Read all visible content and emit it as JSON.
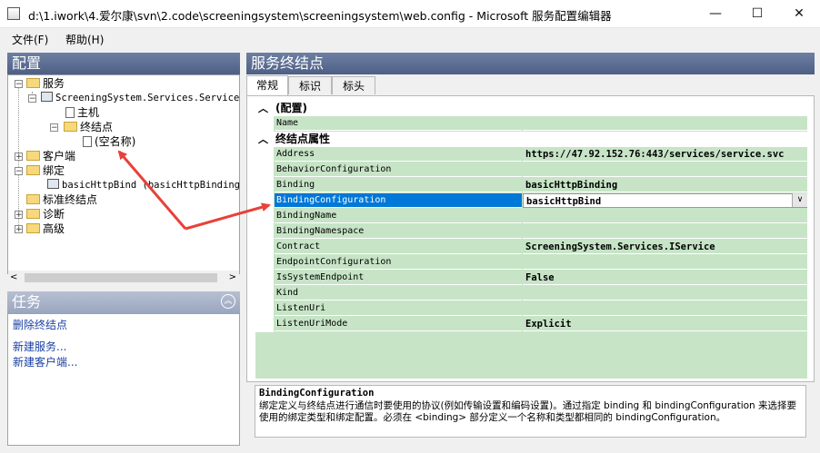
{
  "window": {
    "title": "d:\\1.iwork\\4.爱尔康\\svn\\2.code\\screeningsystem\\screeningsystem\\web.config - Microsoft 服务配置编辑器",
    "minimize": "—",
    "maximize": "☐",
    "close": "✕"
  },
  "menu": {
    "file": "文件(F)",
    "help": "帮助(H)"
  },
  "left": {
    "header": "配置",
    "tree": {
      "services": "服务",
      "service_name": "ScreeningSystem.Services.Service",
      "host": "主机",
      "endpoints": "终结点",
      "empty_name": "(空名称)",
      "client": "客户端",
      "bindings": "绑定",
      "binding_item": "basicHttpBind (basicHttpBinding)",
      "standard_endpoints": "标准终结点",
      "diagnostics": "诊断",
      "advanced": "高级"
    }
  },
  "tasks": {
    "header": "任务",
    "items": [
      "删除终结点",
      "新建服务...",
      "新建客户端..."
    ]
  },
  "right": {
    "header": "服务终结点",
    "tabs": [
      "常规",
      "标识",
      "标头"
    ],
    "category_config": "(配置)",
    "category_endpoint": "终结点属性",
    "config_rows": [
      {
        "name": "Name",
        "value": ""
      }
    ],
    "endpoint_rows": [
      {
        "name": "Address",
        "value": "https://47.92.152.76:443/services/service.svc"
      },
      {
        "name": "BehaviorConfiguration",
        "value": ""
      },
      {
        "name": "Binding",
        "value": "basicHttpBinding"
      },
      {
        "name": "BindingConfiguration",
        "value": "basicHttpBind"
      },
      {
        "name": "BindingName",
        "value": ""
      },
      {
        "name": "BindingNamespace",
        "value": ""
      },
      {
        "name": "Contract",
        "value": "ScreeningSystem.Services.IService"
      },
      {
        "name": "EndpointConfiguration",
        "value": ""
      },
      {
        "name": "IsSystemEndpoint",
        "value": "False"
      },
      {
        "name": "Kind",
        "value": ""
      },
      {
        "name": "ListenUri",
        "value": ""
      },
      {
        "name": "ListenUriMode",
        "value": "Explicit"
      }
    ],
    "description": {
      "title": "BindingConfiguration",
      "text": "绑定定义与终结点进行通信时要使用的协议(例如传输设置和编码设置)。通过指定 binding 和 bindingConfiguration 来选择要使用的绑定类型和绑定配置。必须在 <binding> 部分定义一个名称和类型都相同的 bindingConfiguration。"
    }
  },
  "colors": {
    "header": "#5a6b90",
    "grid": "#c7e4c7",
    "selection": "#0078d7",
    "arrow": "#e8413a"
  }
}
